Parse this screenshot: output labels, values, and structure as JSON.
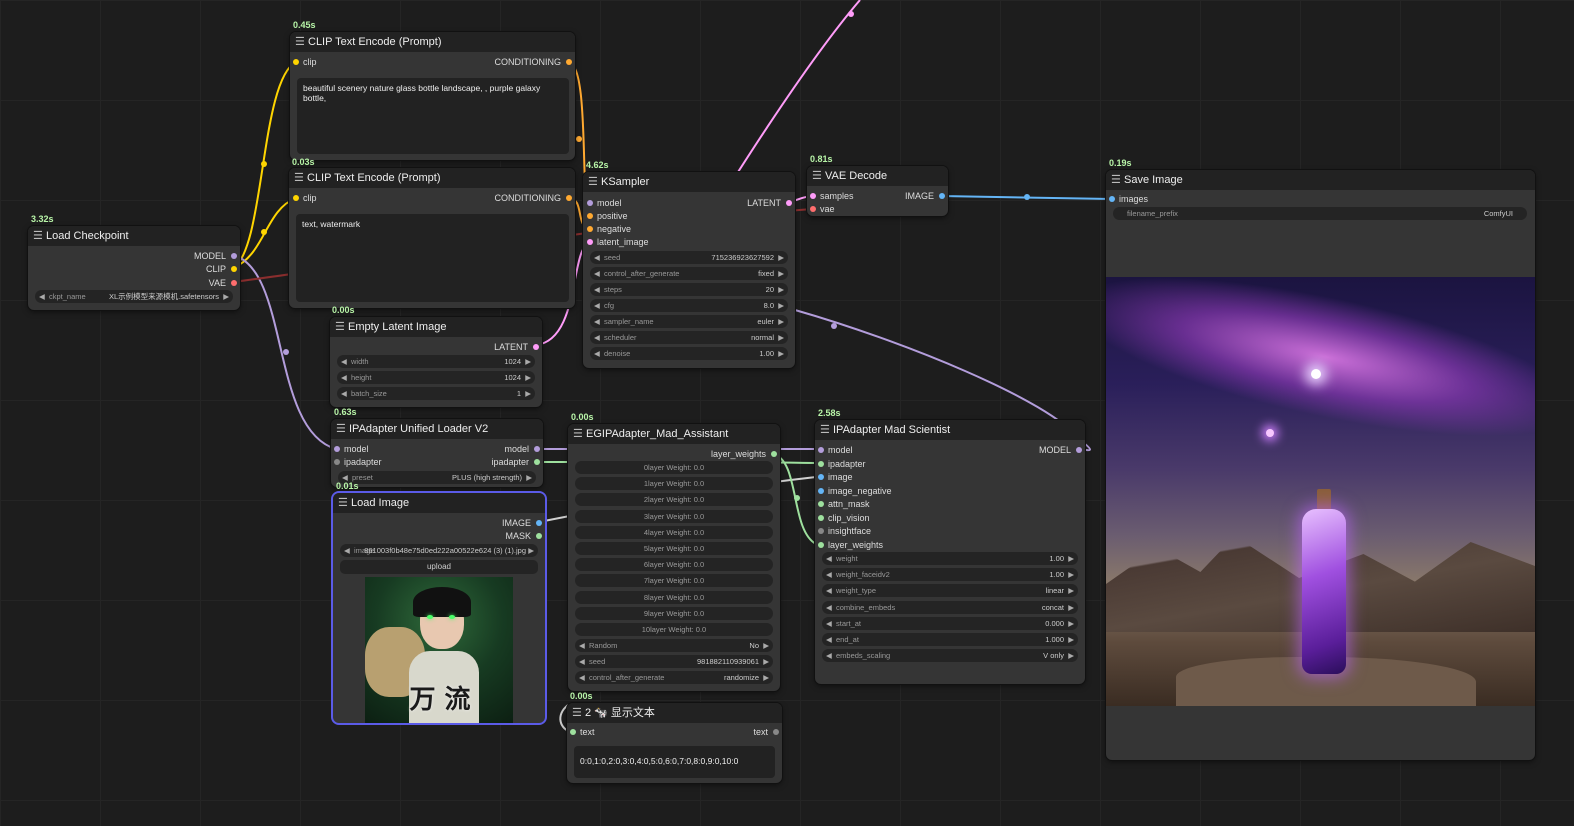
{
  "colors": {
    "clip": "#ffd500",
    "model": "#b39ddb",
    "vae": "#ff6e6e",
    "latent": "#ff9cf9",
    "image": "#64b5f6",
    "ipadapter": "#9ee09e",
    "conditioning": "#ffa931"
  },
  "load_checkpoint": {
    "time": "3.32s",
    "title": "Load Checkpoint",
    "out_model": "MODEL",
    "out_clip": "CLIP",
    "out_vae": "VAE",
    "ckpt_label": "ckpt_name",
    "ckpt_value": "XL示例模型来源模机.safetensors"
  },
  "clip_pos": {
    "time": "0.45s",
    "title": "CLIP Text Encode (Prompt)",
    "in_clip": "clip",
    "out": "CONDITIONING",
    "text": "beautiful scenery nature glass bottle landscape, , purple galaxy bottle,"
  },
  "clip_neg": {
    "time": "0.03s",
    "title": "CLIP Text Encode (Prompt)",
    "in_clip": "clip",
    "out": "CONDITIONING",
    "text": "text, watermark"
  },
  "ksampler": {
    "time": "4.62s",
    "title": "KSampler",
    "inputs": [
      "model",
      "positive",
      "negative",
      "latent_image"
    ],
    "out": "LATENT",
    "widgets": [
      {
        "label": "seed",
        "value": "715236923627592"
      },
      {
        "label": "control_after_generate",
        "value": "fixed"
      },
      {
        "label": "steps",
        "value": "20"
      },
      {
        "label": "cfg",
        "value": "8.0"
      },
      {
        "label": "sampler_name",
        "value": "euler"
      },
      {
        "label": "scheduler",
        "value": "normal"
      },
      {
        "label": "denoise",
        "value": "1.00"
      }
    ]
  },
  "vae_decode": {
    "time": "0.81s",
    "title": "VAE Decode",
    "in_samples": "samples",
    "in_vae": "vae",
    "out": "IMAGE"
  },
  "save_image": {
    "time": "0.19s",
    "title": "Save Image",
    "in_images": "images",
    "prefix_label": "filename_prefix",
    "prefix_value": "ComfyUI"
  },
  "empty_latent": {
    "time": "0.00s",
    "title": "Empty Latent Image",
    "out": "LATENT",
    "widgets": [
      {
        "label": "width",
        "value": "1024"
      },
      {
        "label": "height",
        "value": "1024"
      },
      {
        "label": "batch_size",
        "value": "1"
      }
    ]
  },
  "ip_loader": {
    "time": "0.63s",
    "title": "IPAdapter Unified Loader V2",
    "in_model": "model",
    "in_ipadapter": "ipadapter",
    "out_model": "model",
    "out_ipadapter": "ipadapter",
    "preset_label": "preset",
    "preset_value": "PLUS (high strength)"
  },
  "load_image": {
    "time": "0.01s",
    "title": "Load Image",
    "out_image": "IMAGE",
    "out_mask": "MASK",
    "image_label": "image",
    "image_value": "861003f0b48e75d0ed222a00522e624 (3) (1).jpg",
    "upload": "upload",
    "overlay_text": "万 流"
  },
  "egip": {
    "time": "0.00s",
    "title": "EGIPAdapter_Mad_Assistant",
    "out": "layer_weights",
    "layers": [
      "0layer Weight: 0.0",
      "1layer Weight: 0.0",
      "2layer Weight: 0.0",
      "3layer Weight: 0.0",
      "4layer Weight: 0.0",
      "5layer Weight: 0.0",
      "6layer Weight: 0.0",
      "7layer Weight: 0.0",
      "8layer Weight: 0.0",
      "9layer Weight: 0.0",
      "10layer Weight: 0.0"
    ],
    "widgets": [
      {
        "label": "Random",
        "value": "No"
      },
      {
        "label": "seed",
        "value": "981882110939061"
      },
      {
        "label": "control_after_generate",
        "value": "randomize"
      }
    ]
  },
  "mad_scientist": {
    "time": "2.58s",
    "title": "IPAdapter Mad Scientist",
    "inputs": [
      "model",
      "ipadapter",
      "image",
      "image_negative",
      "attn_mask",
      "clip_vision",
      "insightface",
      "layer_weights"
    ],
    "out": "MODEL",
    "widgets": [
      {
        "label": "weight",
        "value": "1.00"
      },
      {
        "label": "weight_faceidv2",
        "value": "1.00"
      },
      {
        "label": "weight_type",
        "value": "linear"
      },
      {
        "label": "combine_embeds",
        "value": "concat"
      },
      {
        "label": "start_at",
        "value": "0.000"
      },
      {
        "label": "end_at",
        "value": "1.000"
      },
      {
        "label": "embeds_scaling",
        "value": "V only"
      }
    ]
  },
  "show_text": {
    "time": "0.00s",
    "title": "2 🐄 显示文本",
    "in_text": "text",
    "out_text": "text",
    "content": "0:0,1:0,2:0,3:0,4:0,5:0,6:0,7:0,8:0,9:0,10:0"
  }
}
